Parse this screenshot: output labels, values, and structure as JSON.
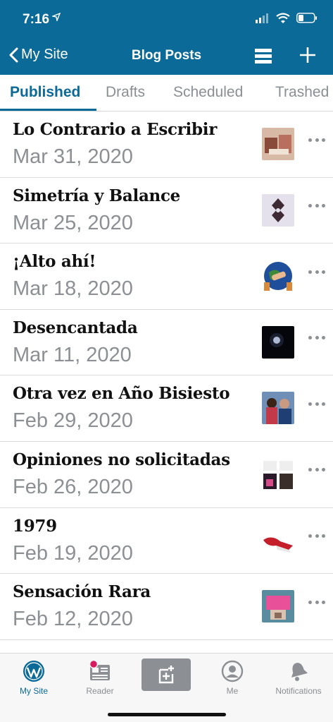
{
  "status": {
    "time": "7:16"
  },
  "nav": {
    "back_label": "My Site",
    "title": "Blog Posts"
  },
  "tabs": [
    "Published",
    "Drafts",
    "Scheduled",
    "Trashed"
  ],
  "posts": [
    {
      "title": "Lo Contrario a Escribir",
      "date": "Mar 31, 2020"
    },
    {
      "title": "Simetría y Balance",
      "date": "Mar 25, 2020"
    },
    {
      "title": "¡Alto ahí!",
      "date": "Mar 18, 2020"
    },
    {
      "title": "Desencantada",
      "date": "Mar 11, 2020"
    },
    {
      "title": "Otra vez en Año Bisiesto",
      "date": "Feb 29, 2020"
    },
    {
      "title": "Opiniones no solicitadas",
      "date": "Feb 26, 2020"
    },
    {
      "title": "1979",
      "date": "Feb 19, 2020"
    },
    {
      "title": "Sensación Rara",
      "date": "Feb 12, 2020"
    }
  ],
  "tabbar": {
    "my_site": "My Site",
    "reader": "Reader",
    "me": "Me",
    "notifications": "Notifications"
  },
  "colors": {
    "brand": "#0b6a97",
    "muted": "#8c8f93"
  }
}
